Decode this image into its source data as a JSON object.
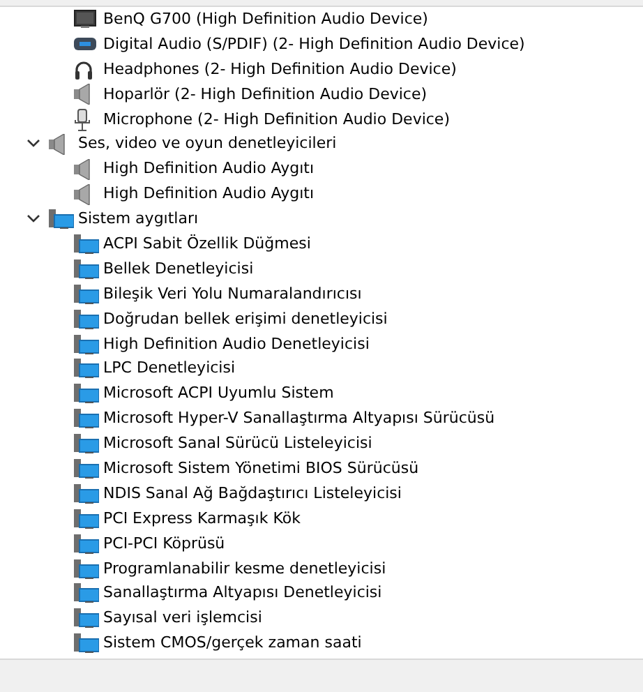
{
  "partial_group": {
    "children": [
      {
        "kind": "monitor",
        "label": "BenQ G700 (High Definition Audio Device)"
      },
      {
        "kind": "spdif",
        "label": "Digital Audio (S/PDIF) (2- High Definition Audio Device)"
      },
      {
        "kind": "headphones",
        "label": "Headphones (2- High Definition Audio Device)"
      },
      {
        "kind": "speaker",
        "label": "Hoparlör (2- High Definition Audio Device)"
      },
      {
        "kind": "microphone",
        "label": "Microphone (2- High Definition Audio Device)"
      }
    ]
  },
  "tree": [
    {
      "kind": "speaker",
      "label": "Ses, video ve oyun denetleyicileri",
      "expanded": true,
      "children": [
        {
          "kind": "speaker",
          "label": "High Definition Audio Aygıtı"
        },
        {
          "kind": "speaker",
          "label": "High Definition Audio Aygıtı"
        }
      ]
    },
    {
      "kind": "system",
      "label": "Sistem aygıtları",
      "expanded": true,
      "children": [
        {
          "kind": "system",
          "label": "ACPI Sabit Özellik Düğmesi"
        },
        {
          "kind": "system",
          "label": "Bellek Denetleyicisi"
        },
        {
          "kind": "system",
          "label": "Bileşik Veri Yolu Numaralandırıcısı"
        },
        {
          "kind": "system",
          "label": "Doğrudan bellek erişimi denetleyicisi"
        },
        {
          "kind": "system",
          "label": "High Definition Audio Denetleyicisi"
        },
        {
          "kind": "system",
          "label": "LPC Denetleyicisi"
        },
        {
          "kind": "system",
          "label": "Microsoft ACPI Uyumlu Sistem"
        },
        {
          "kind": "system",
          "label": "Microsoft Hyper-V Sanallaştırma Altyapısı Sürücüsü"
        },
        {
          "kind": "system",
          "label": "Microsoft Sanal Sürücü Listeleyicisi"
        },
        {
          "kind": "system",
          "label": "Microsoft Sistem Yönetimi BIOS Sürücüsü"
        },
        {
          "kind": "system",
          "label": "NDIS Sanal Ağ Bağdaştırıcı Listeleyicisi"
        },
        {
          "kind": "system",
          "label": "PCI Express Karmaşık Kök"
        },
        {
          "kind": "system",
          "label": "PCI-PCI Köprüsü"
        },
        {
          "kind": "system",
          "label": "Programlanabilir kesme denetleyicisi"
        },
        {
          "kind": "system",
          "label": "Sanallaştırma Altyapısı Denetleyicisi"
        },
        {
          "kind": "system",
          "label": "Sayısal veri işlemcisi"
        },
        {
          "kind": "system",
          "label": "Sistem CMOS/gerçek zaman saati"
        }
      ]
    }
  ]
}
